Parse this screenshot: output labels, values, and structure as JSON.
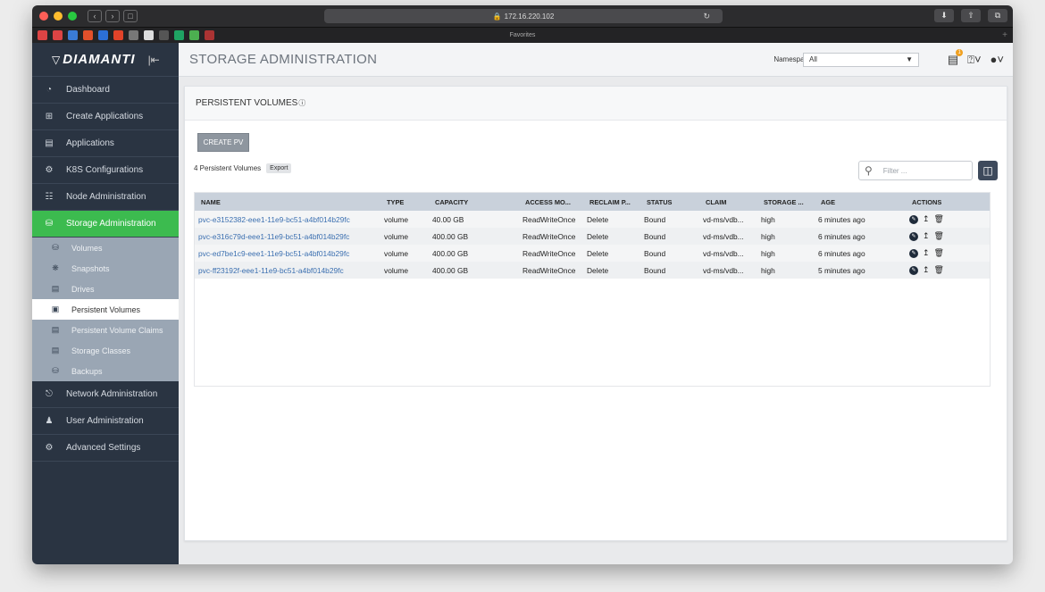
{
  "browser": {
    "url": "172.16.220.102",
    "favorites_label": "Favorites"
  },
  "brand": {
    "name": "DIAMANTI"
  },
  "sidebar": {
    "items": [
      {
        "label": "Dashboard",
        "icon": "dashboard-icon"
      },
      {
        "label": "Create Applications",
        "icon": "plus-square-icon"
      },
      {
        "label": "Applications",
        "icon": "list-icon"
      },
      {
        "label": "K8S Configurations",
        "icon": "kubernetes-icon"
      },
      {
        "label": "Node Administration",
        "icon": "server-icon"
      },
      {
        "label": "Storage Administration",
        "icon": "database-icon",
        "active": true
      }
    ],
    "sub_items": [
      {
        "label": "Volumes",
        "icon": "volume-icon"
      },
      {
        "label": "Snapshots",
        "icon": "snapshot-icon"
      },
      {
        "label": "Drives",
        "icon": "drive-icon"
      },
      {
        "label": "Persistent Volumes",
        "icon": "persistent-volume-icon",
        "active": true
      },
      {
        "label": "Persistent Volume Claims",
        "icon": "pvc-icon"
      },
      {
        "label": "Storage Classes",
        "icon": "storage-class-icon"
      },
      {
        "label": "Backups",
        "icon": "backup-icon"
      }
    ],
    "items_after": [
      {
        "label": "Network Administration",
        "icon": "network-icon"
      },
      {
        "label": "User Administration",
        "icon": "users-icon"
      },
      {
        "label": "Advanced Settings",
        "icon": "settings-icon"
      }
    ]
  },
  "header": {
    "title": "STORAGE ADMINISTRATION",
    "namespace_label": "Namespace",
    "namespace_value": "All",
    "notification_count": "1"
  },
  "main": {
    "section_title": "PERSISTENT VOLUMES",
    "create_button": "CREATE PV",
    "count_text": "4 Persistent Volumes",
    "export_label": "Export",
    "filter_placeholder": "Filter ...",
    "columns": [
      "NAME",
      "TYPE",
      "CAPACITY",
      "ACCESS MO...",
      "RECLAIM P...",
      "STATUS",
      "CLAIM",
      "STORAGE ...",
      "AGE",
      "ACTIONS"
    ],
    "rows": [
      {
        "name": "pvc-e3152382-eee1-11e9-bc51-a4bf014b29fc",
        "type": "volume",
        "capacity": "40.00 GB",
        "access": "ReadWriteOnce",
        "reclaim": "Delete",
        "status": "Bound",
        "claim": "vd-ms/vdb...",
        "storage": "high",
        "age": "6 minutes ago"
      },
      {
        "name": "pvc-e316c79d-eee1-11e9-bc51-a4bf014b29fc",
        "type": "volume",
        "capacity": "400.00 GB",
        "access": "ReadWriteOnce",
        "reclaim": "Delete",
        "status": "Bound",
        "claim": "vd-ms/vdb...",
        "storage": "high",
        "age": "6 minutes ago"
      },
      {
        "name": "pvc-ed7be1c9-eee1-11e9-bc51-a4bf014b29fc",
        "type": "volume",
        "capacity": "400.00 GB",
        "access": "ReadWriteOnce",
        "reclaim": "Delete",
        "status": "Bound",
        "claim": "vd-ms/vdb...",
        "storage": "high",
        "age": "6 minutes ago"
      },
      {
        "name": "pvc-ff23192f-eee1-11e9-bc51-a4bf014b29fc",
        "type": "volume",
        "capacity": "400.00 GB",
        "access": "ReadWriteOnce",
        "reclaim": "Delete",
        "status": "Bound",
        "claim": "vd-ms/vdb...",
        "storage": "high",
        "age": "5 minutes ago"
      }
    ]
  },
  "colors": {
    "sidebar_bg": "#2a3442",
    "active_green": "#3cbb4f",
    "link_blue": "#3b6fb0"
  }
}
